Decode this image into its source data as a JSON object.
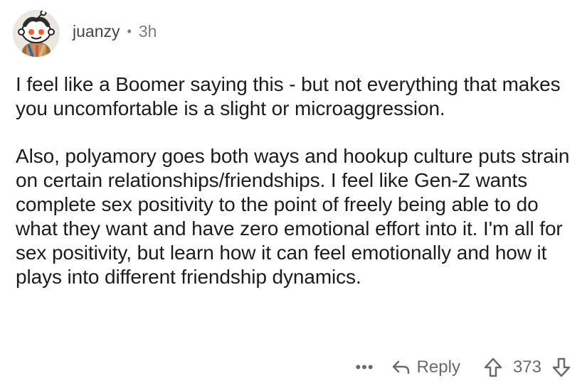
{
  "comment": {
    "author": "juanzy",
    "separator": "•",
    "time": "3h",
    "paragraphs": [
      "I feel like a Boomer saying this - but not everything that makes you uncomfortable is a slight or microaggression.",
      "Also, polyamory goes both ways and hookup culture puts strain on certain relationships/friendships. I feel like Gen-Z wants complete sex positivity to the point of freely being able to do what they want and have zero emotional effort into it. I'm all for sex positivity, but learn how it can feel emotionally and how it plays into different friendship dynamics."
    ]
  },
  "actions": {
    "more_label": "•••",
    "reply_label": "Reply",
    "score": "373",
    "icons": {
      "more": "more-icon",
      "reply": "reply-arrow-icon",
      "upvote": "upvote-arrow-icon",
      "downvote": "downvote-arrow-icon"
    }
  },
  "colors": {
    "text": "#1c1c1c",
    "meta": "#7c7c7c",
    "action": "#6b6b6b"
  }
}
